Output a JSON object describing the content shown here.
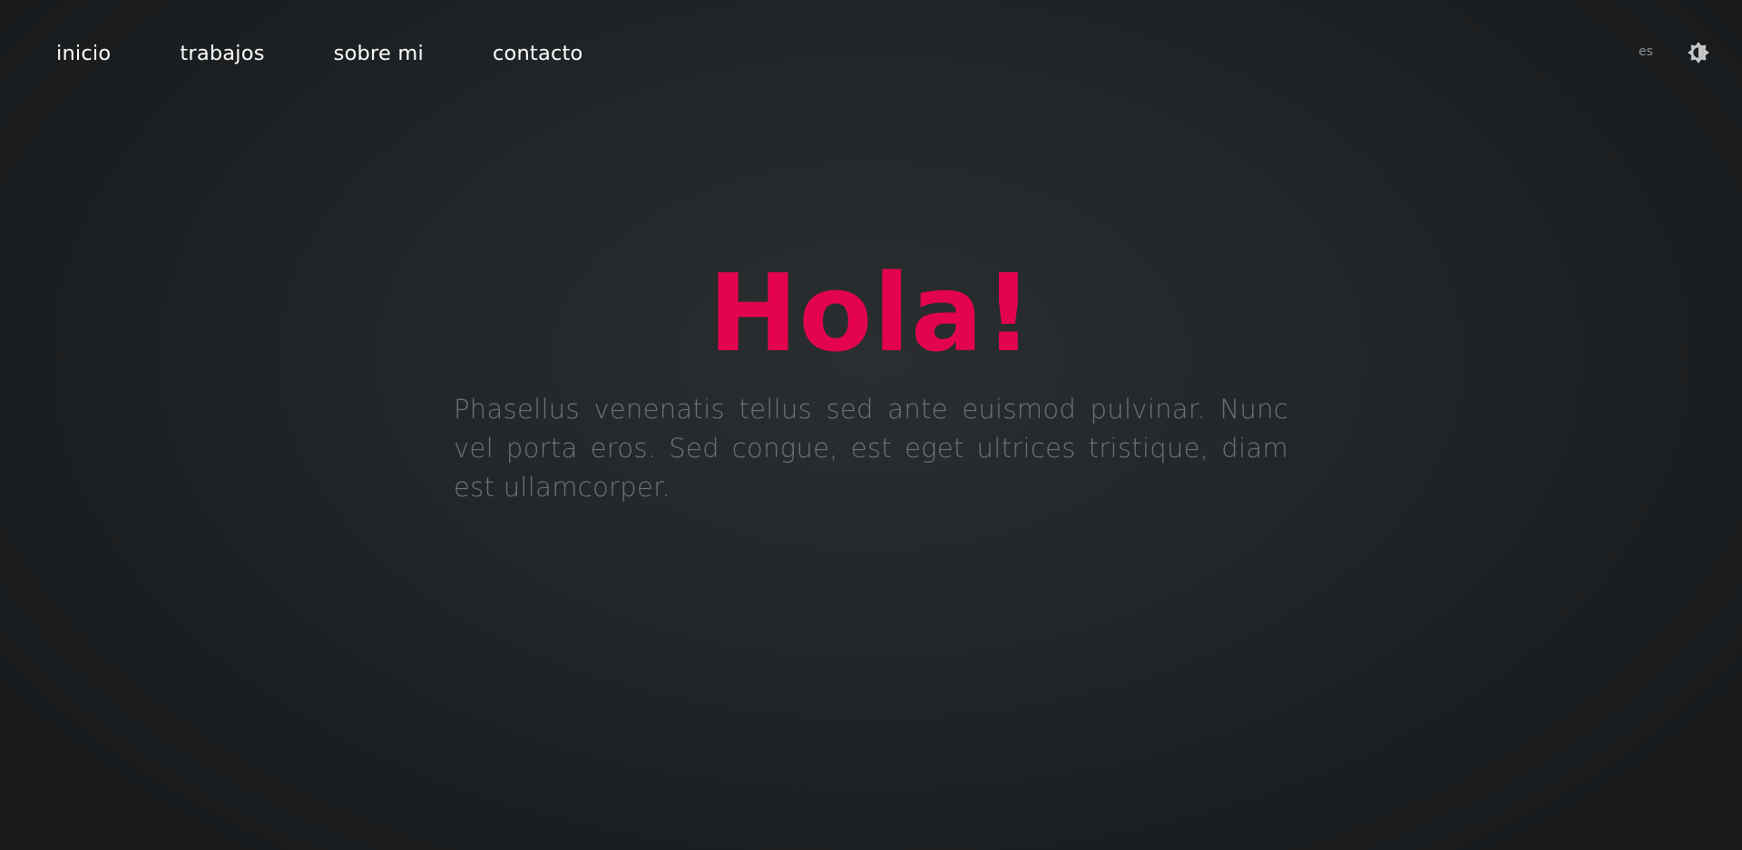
{
  "nav": {
    "items": [
      {
        "label": "inicio"
      },
      {
        "label": "trabajos"
      },
      {
        "label": "sobre mi"
      },
      {
        "label": "contacto"
      }
    ]
  },
  "header": {
    "language": "es",
    "theme_icon": "brightness-icon"
  },
  "hero": {
    "title": "Hola!",
    "text": "Phasellus venenatis tellus sed ante euismod pulvinar. Nunc vel porta eros. Sed congue, est eget ultrices tristique, diam est ullamcorper."
  },
  "colors": {
    "accent": "#e3044d",
    "background": "#222628",
    "body_text": "#6f7375",
    "nav_text": "#ffffff"
  }
}
